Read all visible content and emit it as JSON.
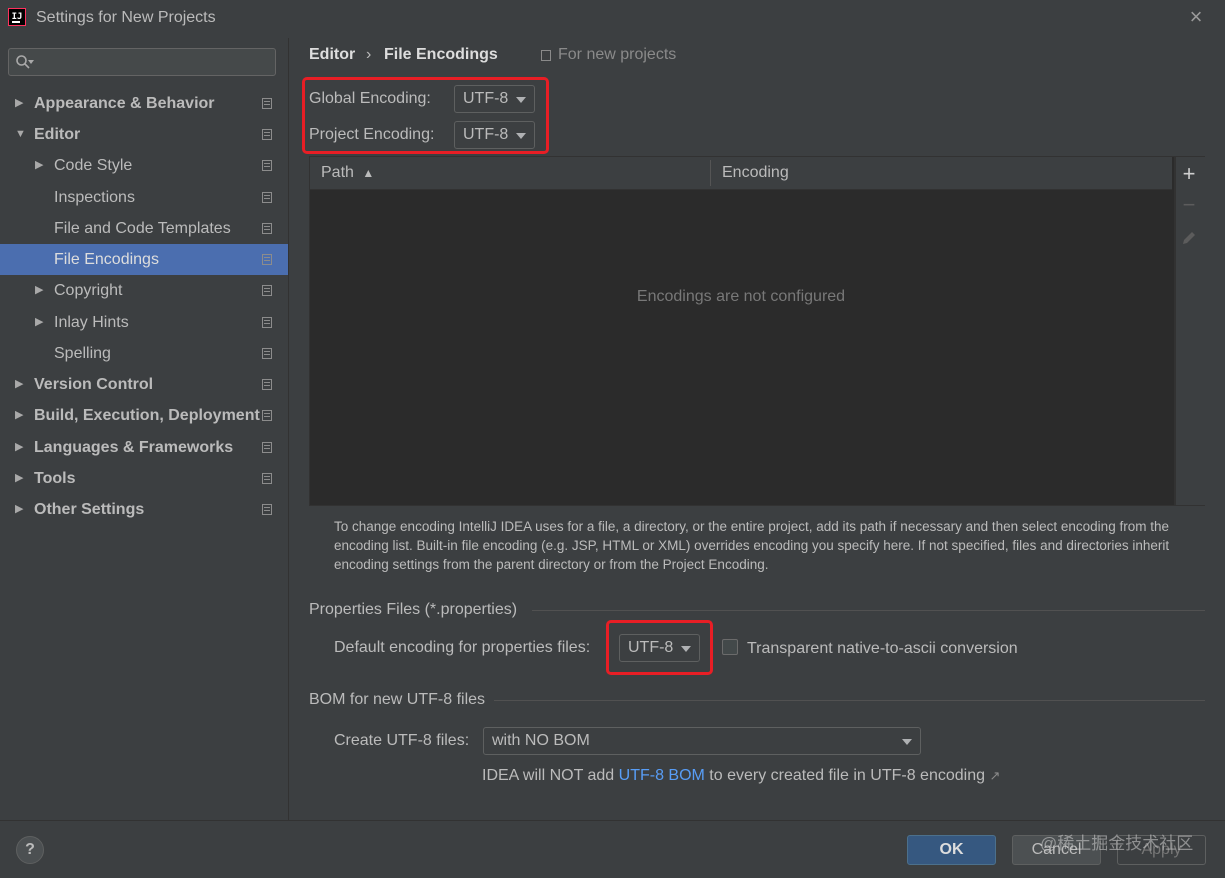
{
  "window": {
    "title": "Settings for New Projects",
    "app_icon_text": "IJ"
  },
  "search": {
    "placeholder": ""
  },
  "sidebar": {
    "items": [
      {
        "label": "Appearance & Behavior",
        "expanded": false,
        "bold": true
      },
      {
        "label": "Editor",
        "expanded": true,
        "bold": true
      },
      {
        "label": "Code Style",
        "expanded": false,
        "bold": false
      },
      {
        "label": "Inspections",
        "bold": false
      },
      {
        "label": "File and Code Templates",
        "bold": false
      },
      {
        "label": "File Encodings",
        "bold": false,
        "selected": true
      },
      {
        "label": "Copyright",
        "expanded": false,
        "bold": false
      },
      {
        "label": "Inlay Hints",
        "expanded": false,
        "bold": false
      },
      {
        "label": "Spelling",
        "bold": false
      },
      {
        "label": "Version Control",
        "expanded": false,
        "bold": true
      },
      {
        "label": "Build, Execution, Deployment",
        "expanded": false,
        "bold": true
      },
      {
        "label": "Languages & Frameworks",
        "expanded": false,
        "bold": true
      },
      {
        "label": "Tools",
        "expanded": false,
        "bold": true
      },
      {
        "label": "Other Settings",
        "expanded": false,
        "bold": true
      }
    ]
  },
  "breadcrumb": {
    "parent": "Editor",
    "separator": "›",
    "current": "File Encodings",
    "scope": "For new projects"
  },
  "encodings": {
    "global_label": "Global Encoding:",
    "global_value": "UTF-8",
    "project_label": "Project Encoding:",
    "project_value": "UTF-8"
  },
  "table": {
    "columns": [
      "Path",
      "Encoding"
    ],
    "sort_indicator": "▲",
    "empty_text": "Encodings are not configured",
    "toolbar": {
      "add": "+",
      "remove": "−"
    }
  },
  "help_text": "To change encoding IntelliJ IDEA uses for a file, a directory, or the entire project, add its path if necessary and then select encoding from the encoding list. Built-in file encoding (e.g. JSP, HTML or XML) overrides encoding you specify here. If not specified, files and directories inherit encoding settings from the parent directory or from the Project Encoding.",
  "properties": {
    "section_title": "Properties Files (*.properties)",
    "default_label": "Default encoding for properties files:",
    "default_value": "UTF-8",
    "transparent_label": "Transparent native-to-ascii conversion",
    "transparent_checked": false
  },
  "bom": {
    "section_title": "BOM for new UTF-8 files",
    "create_label": "Create UTF-8 files:",
    "create_value": "with NO BOM",
    "note_prefix": "IDEA will NOT add ",
    "note_link": "UTF-8 BOM",
    "note_suffix": " to every created file in UTF-8 encoding",
    "note_arrow": "↗"
  },
  "footer": {
    "help": "?",
    "ok": "OK",
    "cancel": "Cancel",
    "apply": "Apply",
    "watermark": "@稀土掘金技术社区"
  },
  "colors": {
    "background": "#3c3f41",
    "selection": "#4b6eaf",
    "highlight_box": "#e81e25",
    "link": "#589df6",
    "ok_button": "#365880"
  }
}
